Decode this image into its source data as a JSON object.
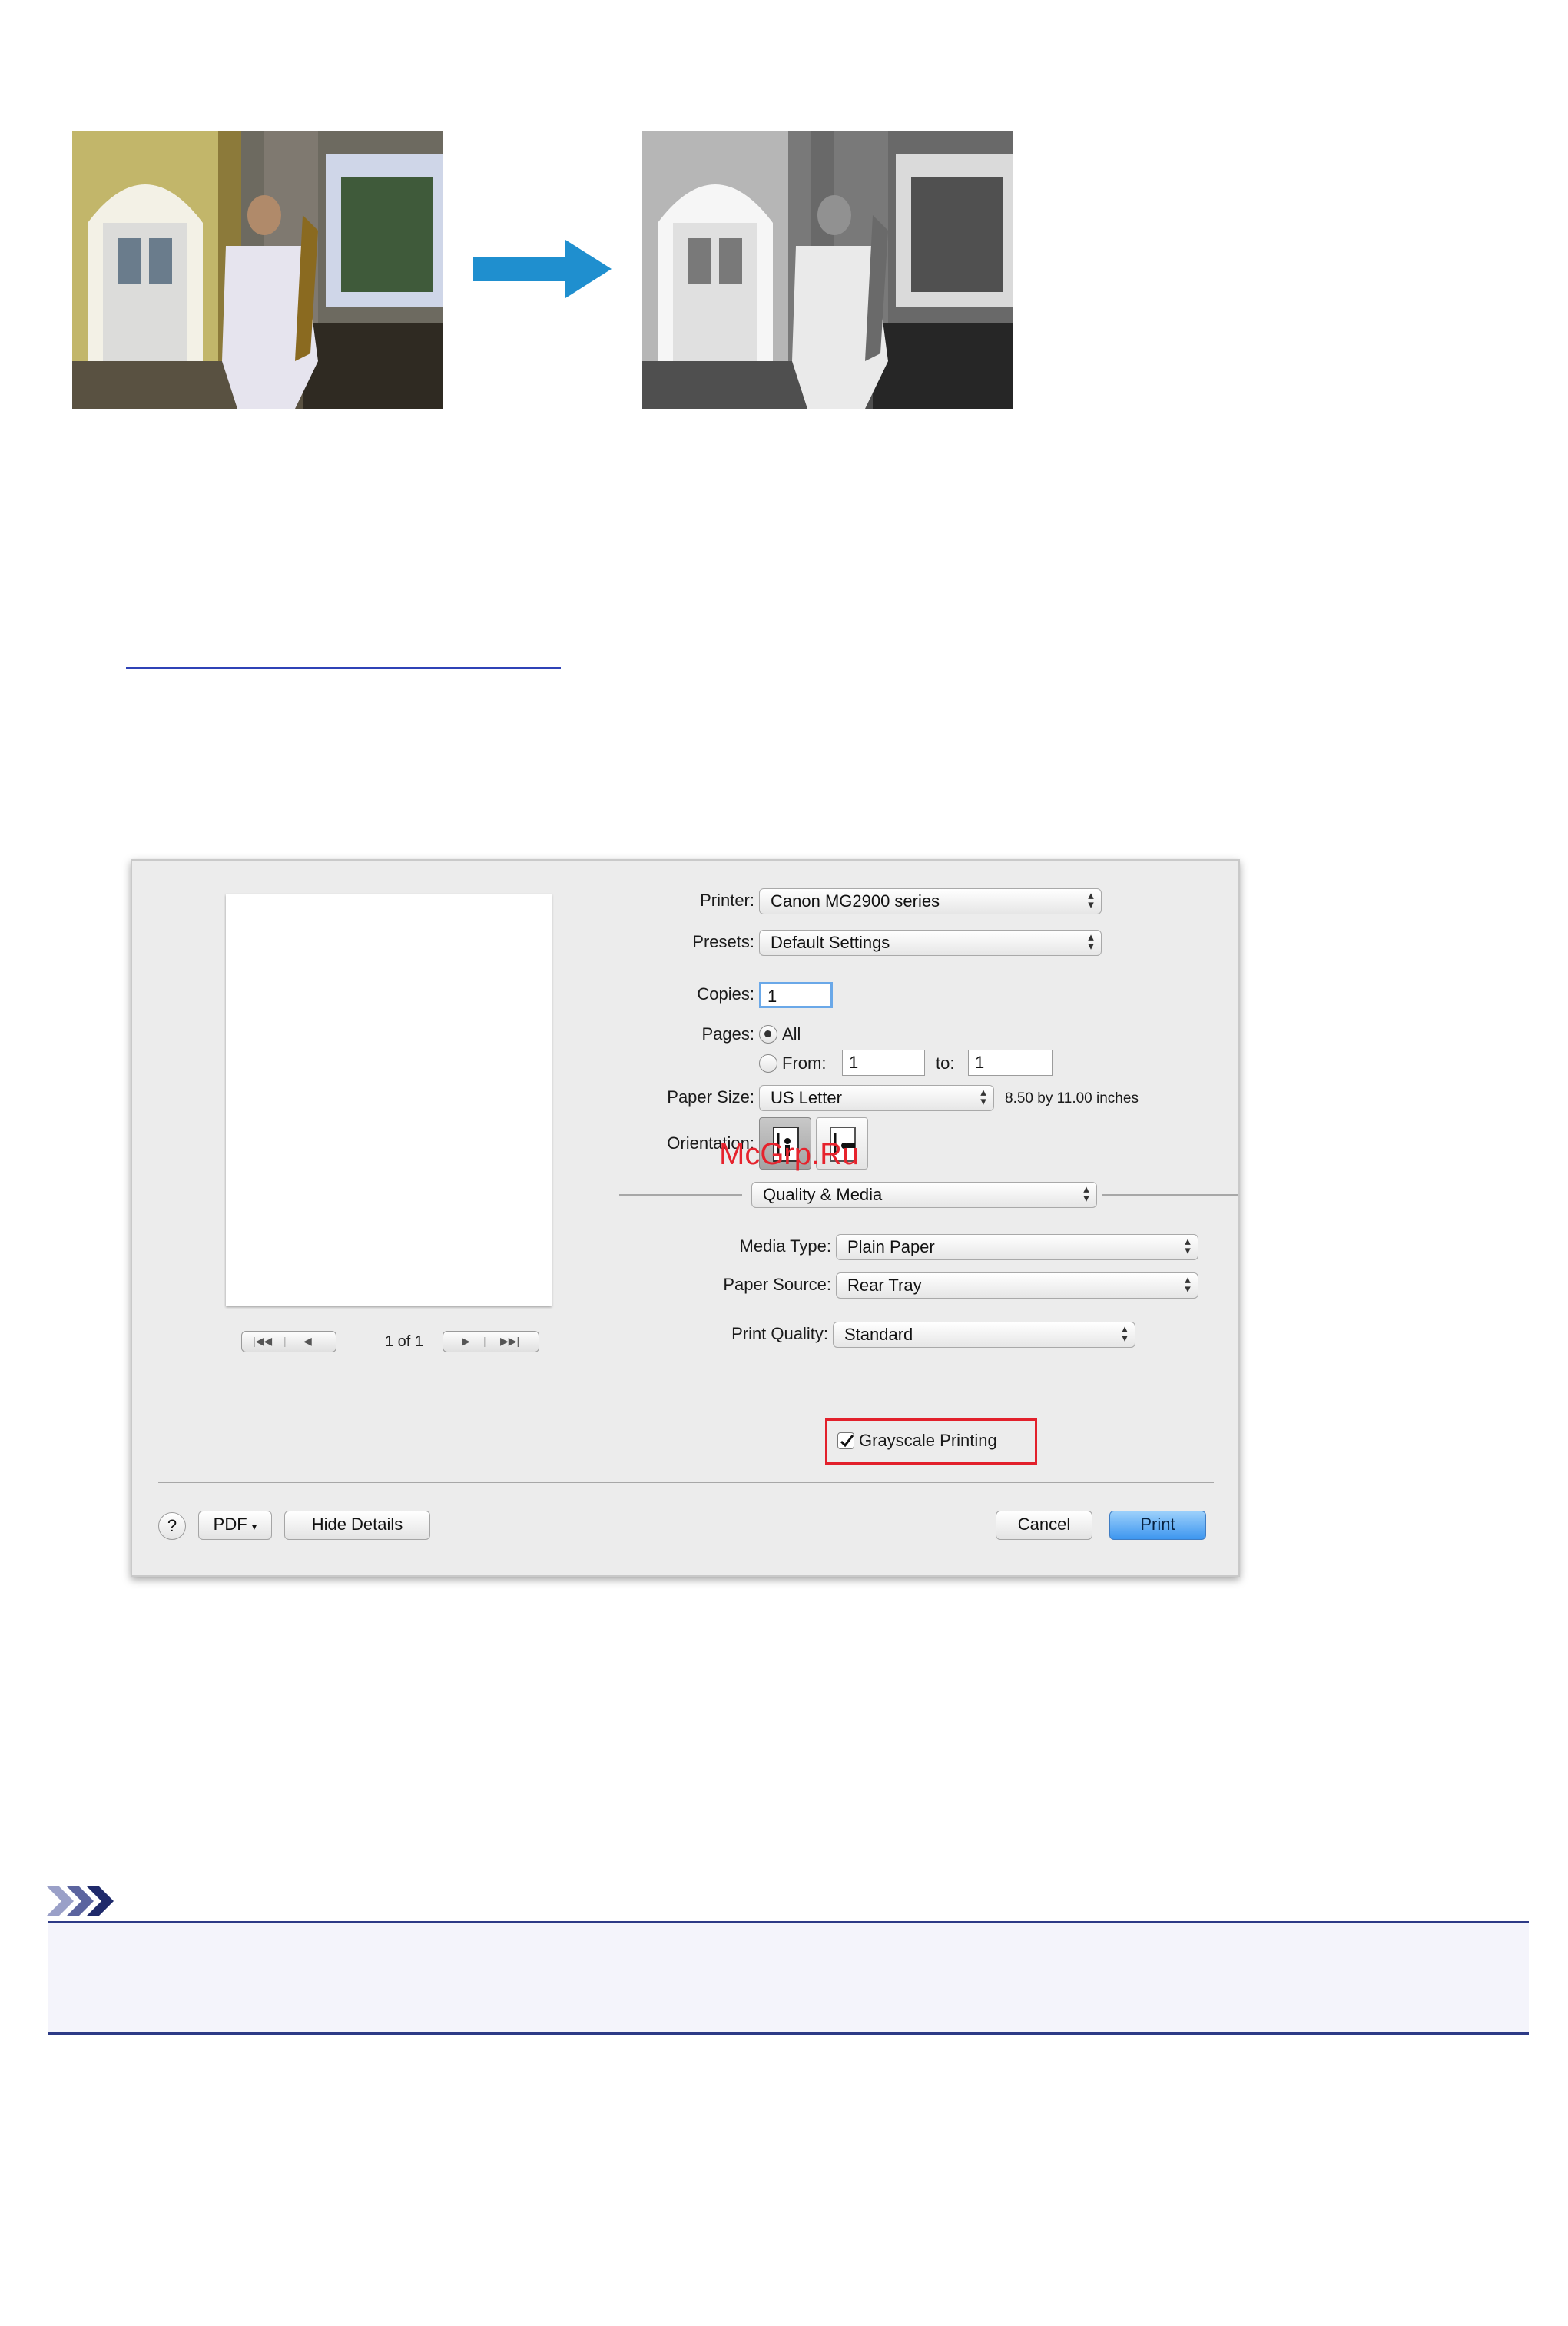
{
  "link": {
    "text": ""
  },
  "dialog": {
    "printer": {
      "label": "Printer:",
      "value": "Canon MG2900 series"
    },
    "presets": {
      "label": "Presets:",
      "value": "Default Settings"
    },
    "copies": {
      "label": "Copies:",
      "value": "1"
    },
    "pages": {
      "label": "Pages:",
      "all_label": "All",
      "from_label": "From:",
      "from_value": "1",
      "to_label": "to:",
      "to_value": "1",
      "selected": "All"
    },
    "paper_size": {
      "label": "Paper Size:",
      "value": "US Letter",
      "dimensions": "8.50 by 11.00 inches"
    },
    "orientation": {
      "label": "Orientation:",
      "selected": "portrait"
    },
    "section_popup": "Quality & Media",
    "media_type": {
      "label": "Media Type:",
      "value": "Plain Paper"
    },
    "paper_source": {
      "label": "Paper Source:",
      "value": "Rear Tray"
    },
    "print_quality": {
      "label": "Print Quality:",
      "value": "Standard"
    },
    "grayscale": {
      "label": "Grayscale Printing",
      "checked": true
    },
    "preview_nav": {
      "page_indicator": "1 of 1"
    },
    "footer": {
      "help": "?",
      "pdf": "PDF",
      "hide_details": "Hide Details",
      "cancel": "Cancel",
      "print": "Print"
    },
    "highlight_color": "#e2202b",
    "accent_color": "#3d96ef"
  },
  "watermark": "McGrp.Ru",
  "arrow_color": "#1f8fcf",
  "note_accent_color": "#2d3a86"
}
